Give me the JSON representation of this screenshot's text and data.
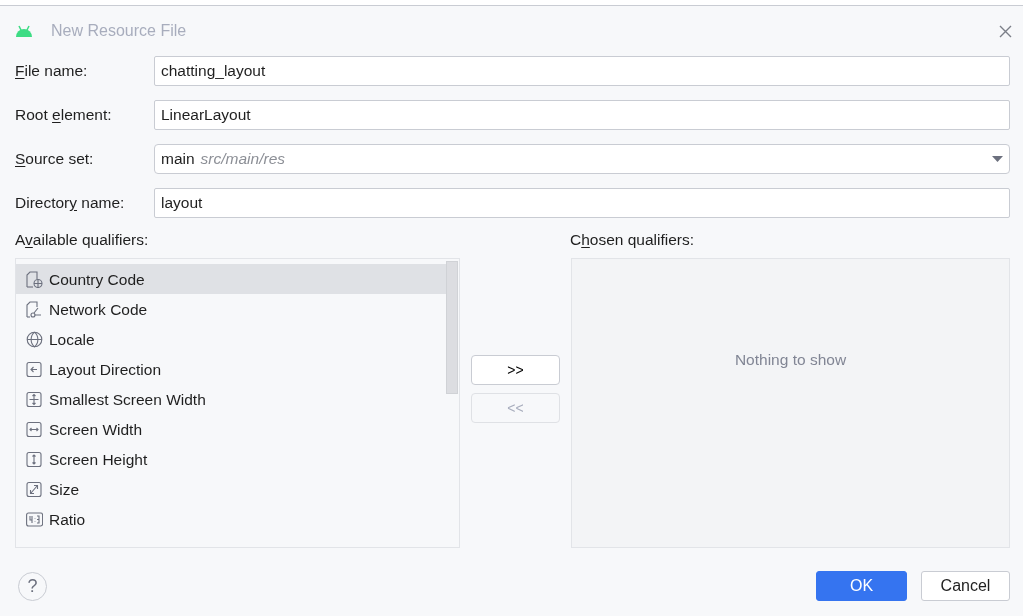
{
  "window": {
    "title": "New Resource File"
  },
  "fields": [
    {
      "label": [
        {
          "text": "F",
          "underline": true
        },
        {
          "text": "ile name:",
          "underline": false
        }
      ],
      "kind": "text",
      "value": "chatting_layout"
    },
    {
      "label": [
        {
          "text": "Root ",
          "underline": false
        },
        {
          "text": "e",
          "underline": true
        },
        {
          "text": "lement:",
          "underline": false
        }
      ],
      "kind": "text",
      "value": "LinearLayout"
    },
    {
      "label": [
        {
          "text": "S",
          "underline": true
        },
        {
          "text": "ource set:",
          "underline": false
        }
      ],
      "kind": "dropdown",
      "value": "main",
      "hint": "src/main/res"
    },
    {
      "label": [
        {
          "text": "Director",
          "underline": false
        },
        {
          "text": "y",
          "underline": true
        },
        {
          "text": " name:",
          "underline": false
        }
      ],
      "kind": "text",
      "value": "layout"
    }
  ],
  "available": {
    "label": [
      {
        "text": "A",
        "underline": false
      },
      {
        "text": "v",
        "underline": true
      },
      {
        "text": "ailable qualifiers:",
        "underline": false
      }
    ],
    "items": [
      {
        "label": "Country Code",
        "kind": "country",
        "selected": true
      },
      {
        "label": "Network Code",
        "kind": "network",
        "selected": false
      },
      {
        "label": "Locale",
        "kind": "globe",
        "selected": false
      },
      {
        "label": "Layout Direction",
        "kind": "direction",
        "selected": false
      },
      {
        "label": "Smallest Screen Width",
        "kind": "smallest",
        "selected": false
      },
      {
        "label": "Screen Width",
        "kind": "width",
        "selected": false
      },
      {
        "label": "Screen Height",
        "kind": "height",
        "selected": false
      },
      {
        "label": "Size",
        "kind": "size",
        "selected": false
      },
      {
        "label": "Ratio",
        "kind": "ratio",
        "selected": false
      }
    ]
  },
  "transfer": [
    {
      "label": ">>",
      "disabled": false
    },
    {
      "label": "<<",
      "disabled": true
    }
  ],
  "chosen": {
    "label": [
      {
        "text": "C",
        "underline": false
      },
      {
        "text": "h",
        "underline": true
      },
      {
        "text": "osen qualifiers:",
        "underline": false
      }
    ],
    "empty_text": "Nothing to show"
  },
  "footer": {
    "help": "?",
    "buttons": [
      {
        "label": "OK",
        "primary": true
      },
      {
        "label": "Cancel",
        "primary": false
      }
    ]
  }
}
